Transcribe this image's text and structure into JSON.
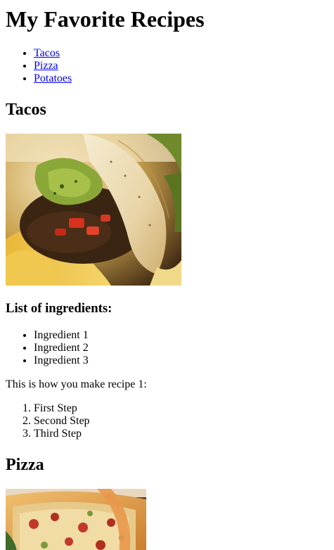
{
  "page": {
    "title": "My Favorite Recipes"
  },
  "nav": {
    "links": [
      "Tacos",
      "Pizza",
      "Potatoes"
    ]
  },
  "recipes": [
    {
      "title": "Tacos",
      "photo_icon": "tacos-photo",
      "ingredients_heading": "List of ingredients:",
      "ingredients": [
        "Ingredient 1",
        "Ingredient 2",
        "Ingredient 3"
      ],
      "method_intro": "This is how you make recipe 1:",
      "steps": [
        "First Step",
        "Second Step",
        "Third Step"
      ]
    },
    {
      "title": "Pizza",
      "photo_icon": "pizza-photo"
    }
  ],
  "colors": {
    "link": "#0000ee",
    "text": "#000000",
    "background": "#ffffff"
  }
}
